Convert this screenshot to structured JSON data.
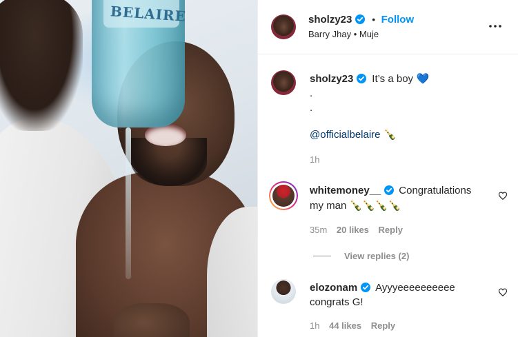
{
  "photo": {
    "bottle_label": "BELAIRE"
  },
  "post": {
    "username": "sholzy23",
    "separator": "•",
    "follow_label": "Follow",
    "subline": "Barry Jhay • Muje",
    "caption_text": "It’s a boy",
    "caption_emoji": "💙",
    "caption_dot1": ".",
    "caption_dot2": ".",
    "mention": "@officialbelaire",
    "mention_emoji": "🍾",
    "time": "1h"
  },
  "comments": [
    {
      "username": "whitemoney__",
      "text_line1": "Congratulations",
      "text_line2": "my man 🍾🍾🍾🍾",
      "time": "35m",
      "likes": "20 likes",
      "reply_label": "Reply",
      "view_replies": "View replies (2)"
    },
    {
      "username": "elozonam",
      "text_line1": "Ayyyeeeeeeeeee",
      "text_line2": "congrats G!",
      "time": "1h",
      "likes": "44 likes",
      "reply_label": "Reply"
    }
  ],
  "icons": {
    "verified": "verified-badge-icon",
    "more": "more-options-icon",
    "heart": "heart-outline-icon"
  },
  "colors": {
    "link": "#0095f6",
    "verified": "#0095f6",
    "muted": "#8e8e8e",
    "mention": "#00376b"
  }
}
